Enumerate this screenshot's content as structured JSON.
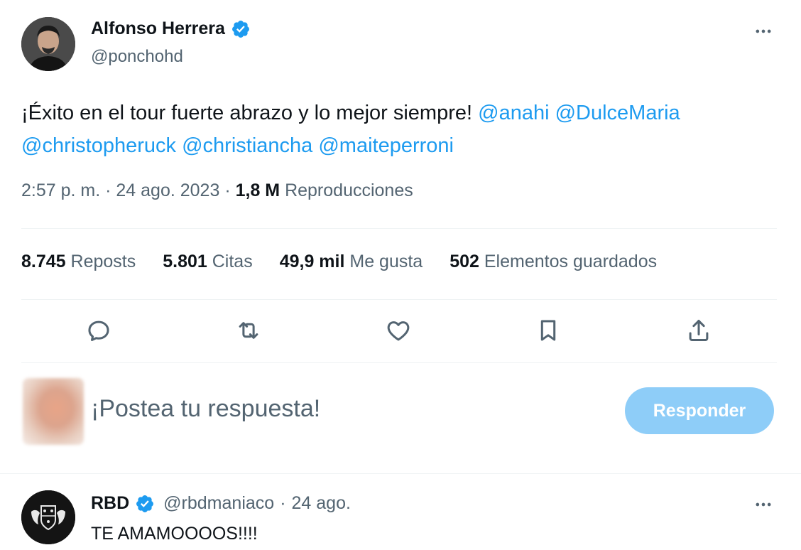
{
  "tweet": {
    "author_name": "Alfonso Herrera",
    "author_handle": "@ponchohd",
    "text_start": "¡Éxito en el tour fuerte abrazo y lo mejor siempre! ",
    "mentions": [
      "@anahi",
      "@DulceMaria",
      "@christopheruck",
      "@christiancha",
      "@maiteperroni"
    ],
    "time": "2:57 p. m.",
    "sep1": " · ",
    "date": "24 ago. 2023",
    "sep2": " · ",
    "views_count": "1,8 M",
    "views_label": " Reproducciones"
  },
  "stats": [
    {
      "count": "8.745",
      "label": " Reposts"
    },
    {
      "count": "5.801",
      "label": " Citas"
    },
    {
      "count": "49,9 mil",
      "label": " Me gusta"
    },
    {
      "count": "502",
      "label": " Elementos guardados"
    }
  ],
  "actions": [
    "reply-icon",
    "repost-icon",
    "like-icon",
    "bookmark-icon",
    "share-icon"
  ],
  "reply_box": {
    "placeholder": "¡Postea tu respuesta!",
    "button_label": "Responder"
  },
  "reply": {
    "author_name": "RBD",
    "author_handle": "@rbdmaniaco",
    "sep": " · ",
    "date": "24 ago.",
    "text": "TE AMAMOOOOS!!!!"
  },
  "colors": {
    "accent": "#1d9bf0",
    "secondary_text": "#536471",
    "primary_text": "#0f1419",
    "button_disabled": "#8ecdf8",
    "divider": "#eff3f4"
  }
}
